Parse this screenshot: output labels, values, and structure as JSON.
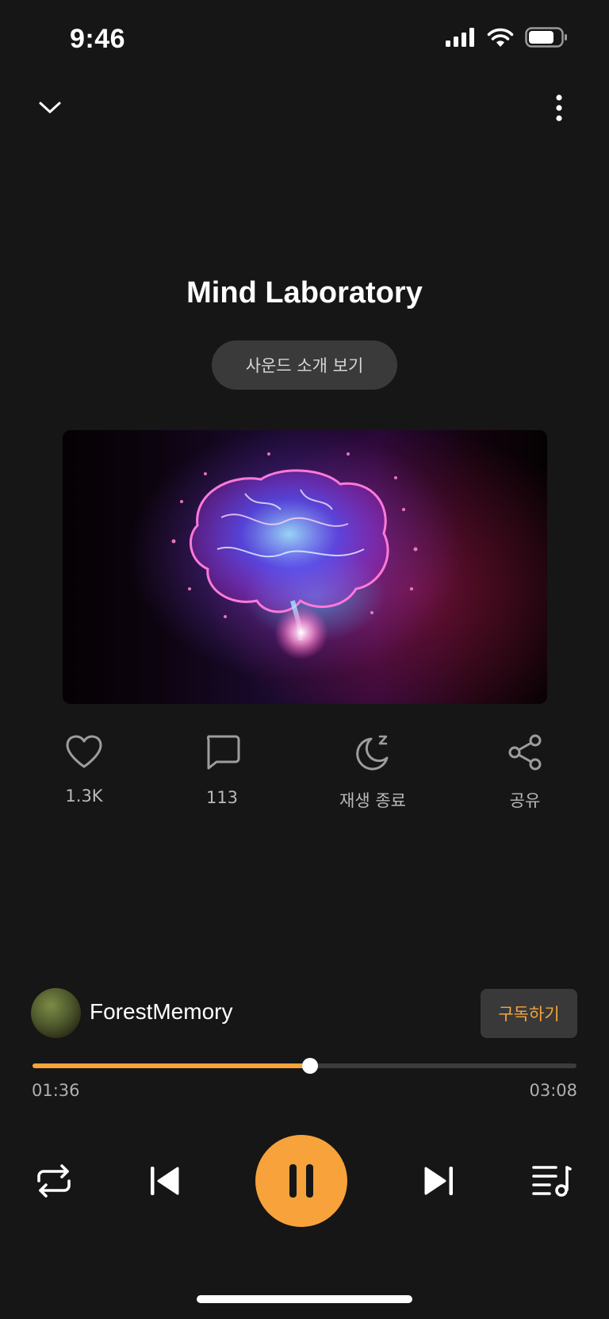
{
  "status_bar": {
    "time": "9:46"
  },
  "track": {
    "title": "Mind Laboratory",
    "intro_label": "사운드 소개 보기"
  },
  "actions": {
    "likes": "1.3K",
    "comments": "113",
    "sleep_timer": "재생 종료",
    "share": "공유"
  },
  "creator": {
    "name": "ForestMemory",
    "subscribe_label": "구독하기"
  },
  "playback": {
    "current_time": "01:36",
    "total_time": "03:08",
    "progress": 0.51,
    "state": "playing"
  },
  "colors": {
    "accent": "#f7a23b",
    "background": "#161616"
  },
  "icons": [
    "chevron-down-icon",
    "more-vertical-icon",
    "heart-icon",
    "comment-icon",
    "moon-sleep-icon",
    "share-icon",
    "repeat-icon",
    "previous-icon",
    "pause-icon",
    "next-icon",
    "playlist-icon"
  ]
}
